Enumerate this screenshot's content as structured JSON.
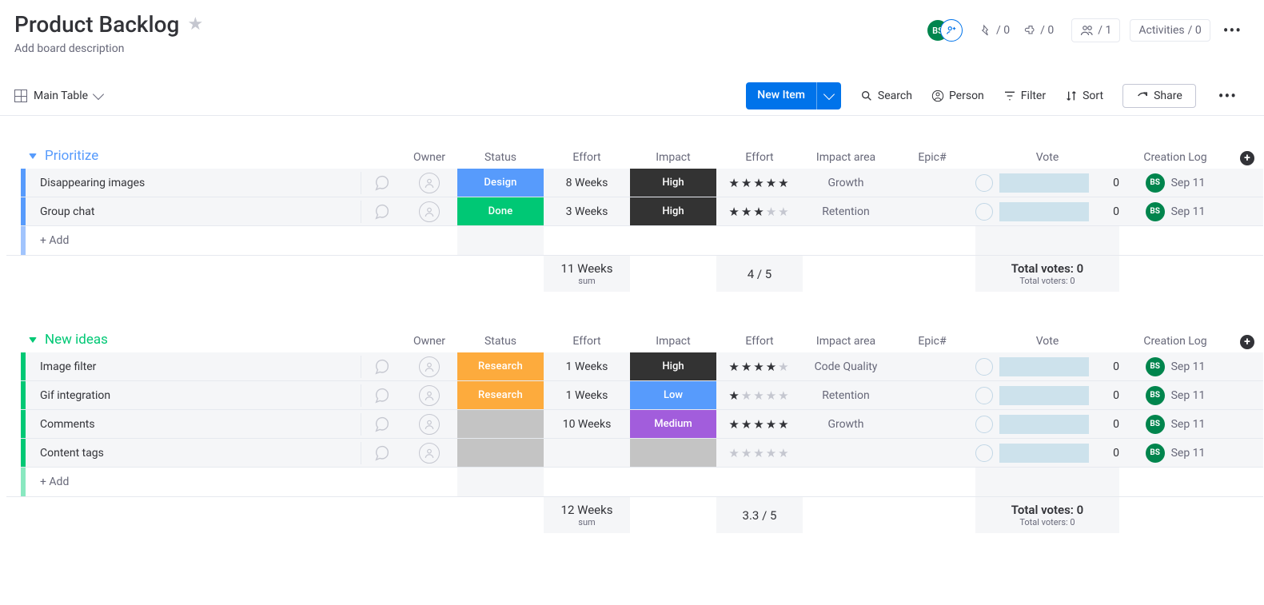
{
  "header": {
    "title": "Product Backlog",
    "subtitle": "Add board description"
  },
  "topstats": {
    "avatar_initials": "BS",
    "automations": "/ 0",
    "integrations": "/ 0",
    "members": "/ 1",
    "activities_label": "Activities",
    "activities_count": "/ 0"
  },
  "toolbar": {
    "main_table": "Main Table",
    "new_item": "New Item",
    "search": "Search",
    "person": "Person",
    "filter": "Filter",
    "sort": "Sort",
    "share": "Share"
  },
  "columns": {
    "owner": "Owner",
    "status": "Status",
    "effort": "Effort",
    "impact": "Impact",
    "effort2": "Effort",
    "impact_area": "Impact area",
    "epic": "Epic#",
    "vote": "Vote",
    "creation": "Creation Log"
  },
  "groups": {
    "prioritize": {
      "title": "Prioritize",
      "rows": [
        {
          "name": "Disappearing images",
          "status_label": "Design",
          "status_color": "#579bfc",
          "effort": "8 Weeks",
          "impact_label": "High",
          "impact_color": "#333333",
          "stars": 5,
          "impact_area": "Growth",
          "vote_count": "0",
          "creator": "BS",
          "date": "Sep 11"
        },
        {
          "name": "Group chat",
          "status_label": "Done",
          "status_color": "#00c875",
          "effort": "3 Weeks",
          "impact_label": "High",
          "impact_color": "#333333",
          "stars": 3,
          "impact_area": "Retention",
          "vote_count": "0",
          "creator": "BS",
          "date": "Sep 11"
        }
      ],
      "add": "+ Add",
      "summary": {
        "effort": "11 Weeks",
        "effort_sub": "sum",
        "stars": "4 / 5",
        "votes_a": "Total votes: 0",
        "votes_b": "Total voters: 0"
      }
    },
    "newideas": {
      "title": "New ideas",
      "rows": [
        {
          "name": "Image filter",
          "status_label": "Research",
          "status_color": "#fdab3d",
          "effort": "1 Weeks",
          "impact_label": "High",
          "impact_color": "#333333",
          "stars": 4,
          "impact_area": "Code Quality",
          "vote_count": "0",
          "creator": "BS",
          "date": "Sep 11"
        },
        {
          "name": "Gif integration",
          "status_label": "Research",
          "status_color": "#fdab3d",
          "effort": "1 Weeks",
          "impact_label": "Low",
          "impact_color": "#579bfc",
          "stars": 1,
          "impact_area": "Retention",
          "vote_count": "0",
          "creator": "BS",
          "date": "Sep 11"
        },
        {
          "name": "Comments",
          "status_label": "",
          "status_color": "#c4c4c4",
          "effort": "10 Weeks",
          "impact_label": "Medium",
          "impact_color": "#a25ddc",
          "stars": 5,
          "impact_area": "Growth",
          "vote_count": "0",
          "creator": "BS",
          "date": "Sep 11"
        },
        {
          "name": "Content tags",
          "status_label": "",
          "status_color": "#c4c4c4",
          "effort": "",
          "impact_label": "",
          "impact_color": "#c4c4c4",
          "stars": 0,
          "impact_area": "",
          "vote_count": "0",
          "creator": "BS",
          "date": "Sep 11"
        }
      ],
      "add": "+ Add",
      "summary": {
        "effort": "12 Weeks",
        "effort_sub": "sum",
        "stars": "3.3 / 5",
        "votes_a": "Total votes: 0",
        "votes_b": "Total voters: 0"
      }
    }
  }
}
